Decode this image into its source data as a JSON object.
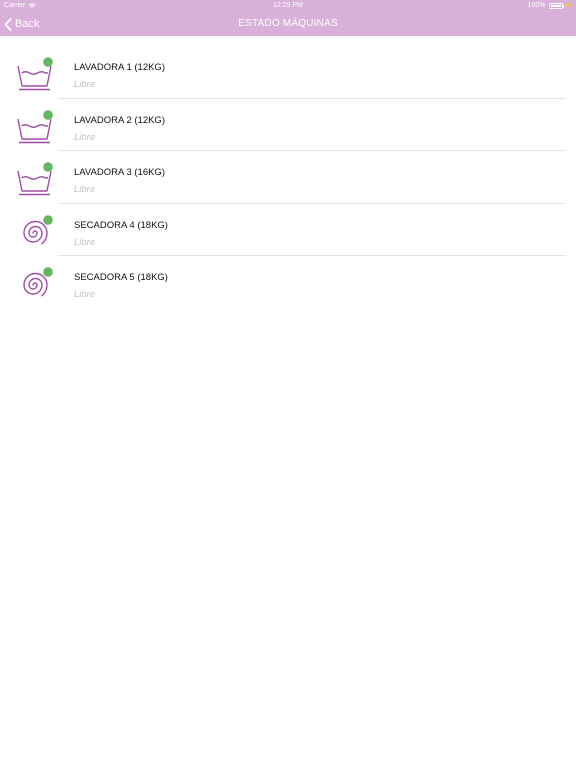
{
  "status_bar": {
    "carrier": "Carrier",
    "time": "12:29 PM",
    "battery": "100%"
  },
  "nav": {
    "back_label": "Back",
    "title": "ESTADO MÁQUINAS"
  },
  "colors": {
    "nav_background": "#d9b0d9",
    "icon_purple": "#a04ea7",
    "status_available": "#62b65f"
  },
  "machines": [
    {
      "name": "LAVADORA 1 (12KG)",
      "status": "Libre",
      "icon": "washer-icon"
    },
    {
      "name": "LAVADORA 2 (12KG)",
      "status": "Libre",
      "icon": "washer-icon"
    },
    {
      "name": "LAVADORA 3 (16KG)",
      "status": "Libre",
      "icon": "washer-icon"
    },
    {
      "name": "SECADORA 4 (18KG)",
      "status": "Libre",
      "icon": "dryer-icon"
    },
    {
      "name": "SECADORA 5 (18KG)",
      "status": "Libre",
      "icon": "dryer-icon"
    }
  ]
}
